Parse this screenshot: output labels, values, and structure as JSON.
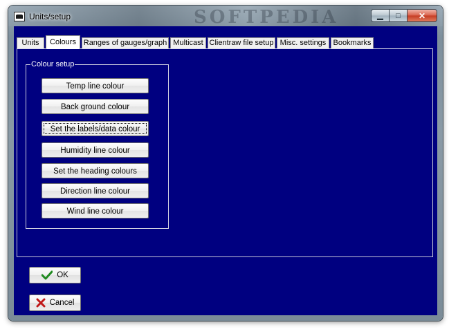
{
  "window": {
    "title": "Units/setup",
    "watermark": "SOFTPEDIA"
  },
  "tabs": [
    {
      "label": "Units",
      "active": false
    },
    {
      "label": "Colours",
      "active": true
    },
    {
      "label": "Ranges of gauges/graph",
      "active": false
    },
    {
      "label": "Multicast",
      "active": false
    },
    {
      "label": "Clientraw file setup",
      "active": false
    },
    {
      "label": "Misc. settings",
      "active": false
    },
    {
      "label": "Bookmarks",
      "active": false
    }
  ],
  "colour_setup": {
    "group_label": "Colour setup",
    "buttons": [
      "Temp line colour",
      "Back ground colour",
      "Set the labels/data colour",
      "Humidity line colour",
      "Set the heading colours",
      "Direction line colour",
      "Wind line colour"
    ],
    "ghost_watermark": "SOFTPEDIA"
  },
  "actions": {
    "ok_label": "OK",
    "cancel_label": "Cancel"
  },
  "colors": {
    "client_background": "#000080",
    "ok_check": "#1f8a1f",
    "cancel_x": "#c01818"
  }
}
